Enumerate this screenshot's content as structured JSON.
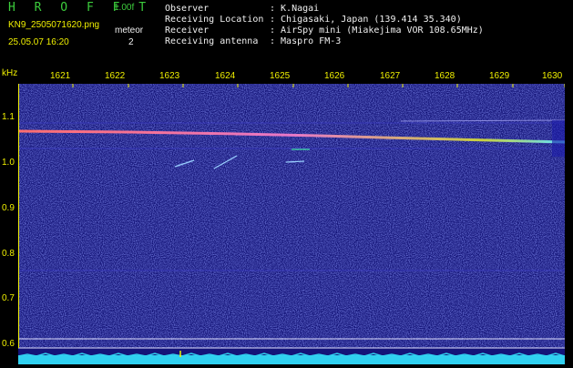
{
  "header": {
    "app_title": "H R O F F T",
    "version": "1.00f",
    "filename": "KN9_2505071620.png",
    "datetime": "25.05.07 16:20",
    "mode": "meteor",
    "count": "2"
  },
  "observation": {
    "observer_label": "Observer",
    "observer_value": ": K.Nagai",
    "location_label": "Receiving Location",
    "location_value": ": Chigasaki, Japan (139.414 35.340)",
    "receiver_label": "Receiver",
    "receiver_value": ": AirSpy mini (Miakejima VOR 108.65MHz)",
    "antenna_label": "Receiving antenna",
    "antenna_value": ": Maspro FM-3"
  },
  "axis": {
    "unit": "kHz",
    "time_ticks": [
      "1621",
      "1622",
      "1623",
      "1624",
      "1625",
      "1626",
      "1627",
      "1628",
      "1629",
      "1630"
    ],
    "freq_ticks": [
      "1.1",
      "1.0",
      "0.9",
      "0.8",
      "0.7",
      "0.6"
    ]
  },
  "colors": {
    "background": "#000000",
    "spectrogram_base": "#1a1a8c",
    "label": "#f0f000",
    "title": "#3ccc3c",
    "meta": "#f0f0f0",
    "signal": "#ff6060"
  }
}
